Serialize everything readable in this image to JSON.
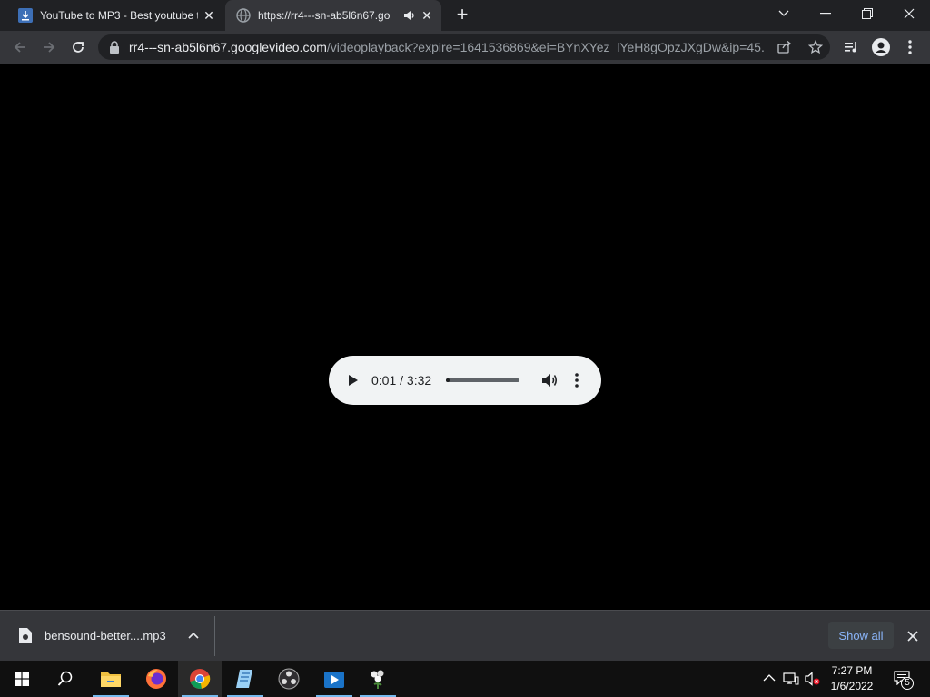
{
  "tabs": [
    {
      "title": "YouTube to MP3 - Best youtube t",
      "favicon": "download-icon"
    },
    {
      "title": "https://rr4---sn-ab5l6n67.go",
      "favicon": "globe-icon",
      "audio": "speaker-icon"
    }
  ],
  "address": {
    "host": "rr4---sn-ab5l6n67.googlevideo.com",
    "path": "/videoplayback?expire=1641536869&ei=BYnXYez_lYeH8gOpzJXgDw&ip=45...."
  },
  "player": {
    "time": "0:01 / 3:32",
    "progress_fraction": 0.005
  },
  "download": {
    "filename": "bensound-better....mp3",
    "show_all": "Show all"
  },
  "taskbar": {
    "time": "7:27 PM",
    "date": "1/6/2022",
    "notification_count": "5"
  },
  "colors": {
    "tab_bar": "#202124",
    "toolbar": "#35363a",
    "link_blue": "#8ab4f8",
    "player_bg": "#f1f3f4"
  }
}
